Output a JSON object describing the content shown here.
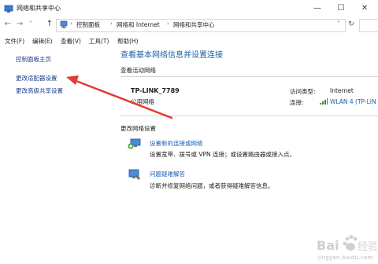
{
  "window": {
    "title": "网络和共享中心",
    "controls": [
      "—",
      "☐",
      "✕"
    ]
  },
  "address_bar": {
    "back": "←",
    "forward": "→",
    "recent": "˅",
    "up": "↑",
    "crumbs": [
      "控制面板",
      "网络和 Internet",
      "网络和共享中心"
    ],
    "separator": "›",
    "dropdown": "˅",
    "refresh": "↻"
  },
  "menu": {
    "items": [
      "文件(F)",
      "编辑(E)",
      "查看(V)",
      "工具(T)",
      "帮助(H)"
    ]
  },
  "sidebar": {
    "items": [
      "控制面板主页",
      "更改适配器设置",
      "更改高级共享设置"
    ]
  },
  "main": {
    "title": "查看基本网络信息并设置连接",
    "active_networks_heading": "查看活动网络",
    "network": {
      "name": "TP-LINK_7789",
      "type": "公用网络",
      "access_type_label": "访问类型:",
      "access_type_value": "Internet",
      "connection_label": "连接:",
      "connection_value": "WLAN 4 (TP-LIN"
    },
    "change_settings_heading": "更改网络设置",
    "tasks": [
      {
        "link": "设置新的连接或网络",
        "description": "设置宽带、拨号或 VPN 连接；或设置路由器或接入点。",
        "icon": "new-connection-icon"
      },
      {
        "link": "问题疑难解答",
        "description": "诊断并修复网络问题，或者获得疑难解答信息。",
        "icon": "troubleshoot-icon"
      }
    ]
  },
  "watermark": {
    "text": "Bai度经验",
    "url": "jingyan.baidu.com"
  },
  "colors": {
    "link": "#1a5fb4",
    "title": "#1f5fa8",
    "arrow": "#e53935"
  }
}
